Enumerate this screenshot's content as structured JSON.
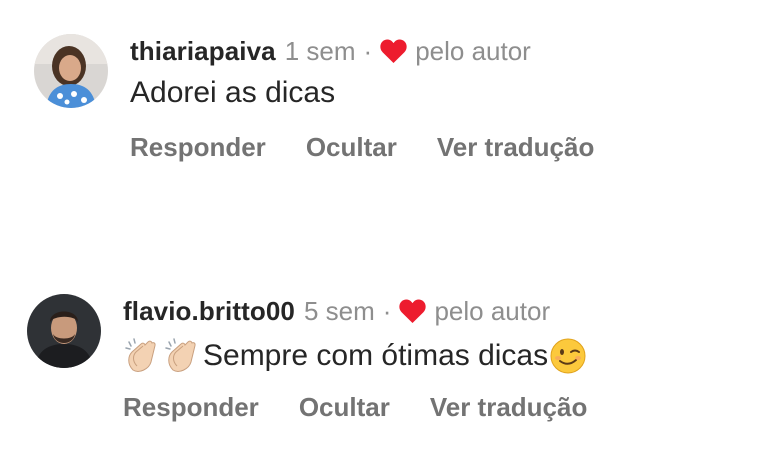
{
  "comments": [
    {
      "username": "thiariapaiva",
      "time": "1 sem",
      "separator": "·",
      "liked_by": "pelo autor",
      "text": "Adorei as dicas",
      "actions": {
        "reply": "Responder",
        "hide": "Ocultar",
        "translate": "Ver tradução"
      },
      "avatar_icon": "user-avatar-woman"
    },
    {
      "username": "flavio.britto00",
      "time": "5 sem",
      "separator": "·",
      "liked_by": "pelo autor",
      "text": "Sempre com ótimas dicas",
      "text_prefix_emoji": [
        "clapping-hands-emoji",
        "clapping-hands-emoji"
      ],
      "text_suffix_emoji": "winking-face-emoji",
      "actions": {
        "reply": "Responder",
        "hide": "Ocultar",
        "translate": "Ver tradução"
      },
      "avatar_icon": "user-avatar-man"
    }
  ],
  "colors": {
    "username": "#262626",
    "secondary": "#8e8e8e",
    "action": "#737373",
    "heart": "#ed1c2e"
  }
}
